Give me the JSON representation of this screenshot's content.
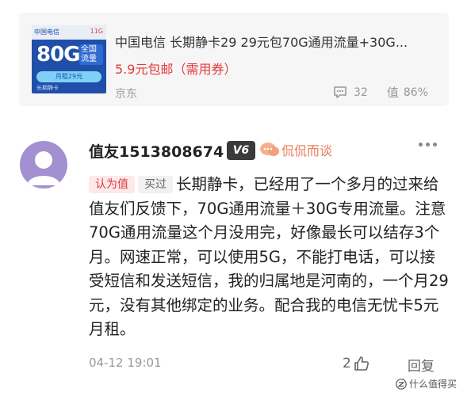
{
  "product": {
    "thumbnail": {
      "brand": "中国电信",
      "tag": "11G",
      "big_text": "80G",
      "label": "全国流量",
      "band_text": "月租29元",
      "sub_text": "长期静卡"
    },
    "title": "中国电信 长期静卡29 29元包70G通用流量+30G...",
    "price": "5.9元包邮（需用券）",
    "source": "京东",
    "comment_count": "32",
    "worth_rate": "86%",
    "worth_glyph": "值"
  },
  "comment": {
    "username": "值友1513808674",
    "level": "V6",
    "medal_label": "侃侃而谈",
    "tag_worth": "认为值",
    "tag_bought": "买过",
    "text": "长期静卡，已经用了一个多月的过来给值友们反馈下，70G通用流量＋30G专用流量。注意70G通用流量这个月没用完，好像最长可以结存3个月。网速正常，可以使用5G，不能打电话，可以接受短信和发送短信，我的归属地是河南的，一个月29元，没有其他绑定的业务。配合我的电信无忧卡5元月租。",
    "time": "04-12 19:01",
    "likes": "2",
    "reply_label": "回复"
  },
  "watermark": "什么值得买",
  "colors": {
    "price_red": "#e4393c",
    "medal_orange": "#e97c5a",
    "avatar_purple": "#a290d0",
    "card_bg": "#f6f6f6"
  }
}
